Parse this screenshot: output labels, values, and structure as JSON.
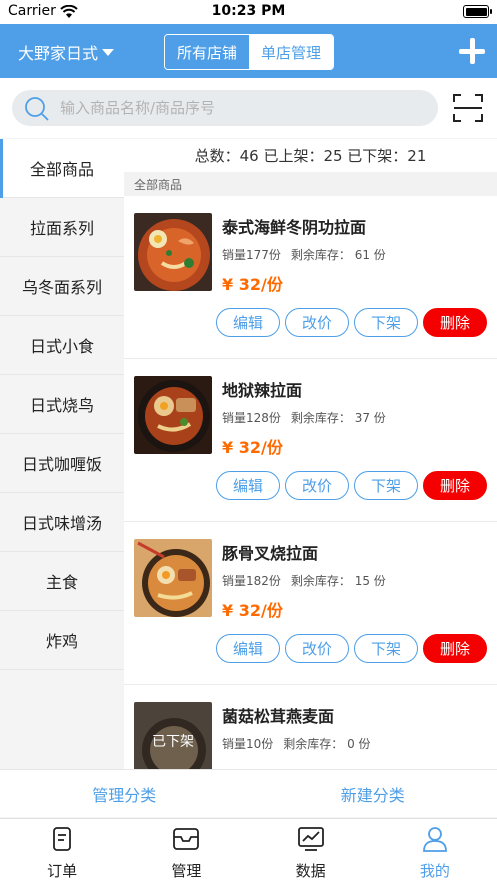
{
  "status_bar": {
    "carrier": "Carrier",
    "time": "10:23 PM"
  },
  "header": {
    "store_name": "大野家日式",
    "segments": [
      "所有店铺",
      "单店管理"
    ],
    "active_segment": 0
  },
  "search": {
    "placeholder": "输入商品名称/商品序号"
  },
  "sidebar": {
    "categories": [
      "全部商品",
      "拉面系列",
      "乌冬面系列",
      "日式小食",
      "日式烧鸟",
      "日式咖喱饭",
      "日式味增汤",
      "主食",
      "炸鸡"
    ],
    "active_index": 0
  },
  "summary": {
    "text": "总数：46 已上架：25 已下架：21"
  },
  "section_title": "全部商品",
  "products": [
    {
      "name": "泰式海鲜冬阴功拉面",
      "sales": "销量177份",
      "stock": "剩余库存：  61 份",
      "price": "¥ 32/份",
      "offshelf": ""
    },
    {
      "name": "地狱辣拉面",
      "sales": "销量128份",
      "stock": "剩余库存：  37 份",
      "price": "¥ 32/份",
      "offshelf": ""
    },
    {
      "name": "豚骨叉烧拉面",
      "sales": "销量182份",
      "stock": "剩余库存：  15 份",
      "price": "¥ 32/份",
      "offshelf": ""
    },
    {
      "name": "菌菇松茸燕麦面",
      "sales": "销量10份",
      "stock": "剩余库存：  0 份",
      "price": "",
      "offshelf": "已下架"
    }
  ],
  "product_actions": {
    "edit": "编辑",
    "reprice": "改价",
    "take_down": "下架",
    "delete": "删除"
  },
  "category_actions": {
    "manage": "管理分类",
    "create": "新建分类"
  },
  "tabbar": {
    "tabs": [
      {
        "label": "订单",
        "icon": "order-icon"
      },
      {
        "label": "管理",
        "icon": "manage-icon"
      },
      {
        "label": "数据",
        "icon": "data-chart-icon"
      },
      {
        "label": "我的",
        "icon": "profile-icon"
      }
    ],
    "active_index": 3
  },
  "colors": {
    "primary": "#4e9fe8",
    "danger": "#f40000",
    "price": "#ff6a00"
  }
}
